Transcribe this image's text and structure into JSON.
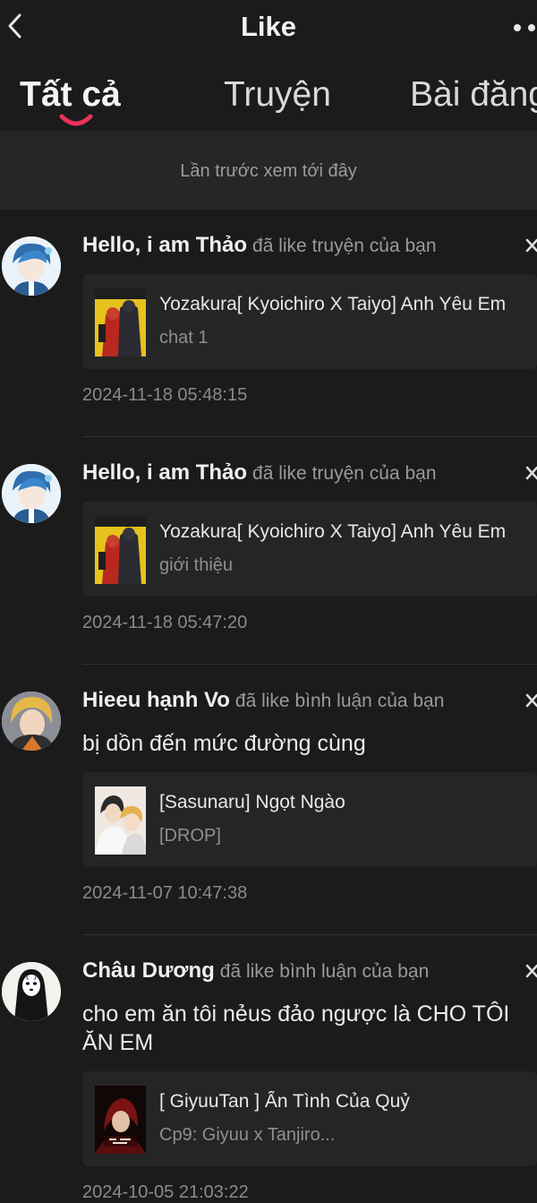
{
  "header": {
    "title": "Like",
    "back_icon": "chevron-left-icon",
    "more_icon": "more-dots-icon"
  },
  "tabs": [
    {
      "label": "Tất cả",
      "active": true
    },
    {
      "label": "Truyện",
      "active": false
    },
    {
      "label": "Bài đăng",
      "active": false
    }
  ],
  "banner": {
    "text": "Lần trước xem tới đây"
  },
  "notifications": [
    {
      "user": "Hello, i am Thảo",
      "action": "đã like truyện của bạn",
      "comment": "",
      "story_title": "Yozakura[ Kyoichiro X Taiyo] Anh Yêu Em",
      "story_sub": "chat 1",
      "time": "2024-11-18 05:48:15"
    },
    {
      "user": "Hello, i am Thảo",
      "action": "đã like truyện của bạn",
      "comment": "",
      "story_title": "Yozakura[ Kyoichiro X Taiyo] Anh Yêu Em",
      "story_sub": "giới thiệu",
      "time": "2024-11-18 05:47:20"
    },
    {
      "user": "Hieeu hạnh Vo",
      "action": "đã like bình luận của bạn",
      "comment": "bị dồn đến mức đường cùng",
      "story_title": "[Sasunaru] Ngọt Ngào",
      "story_sub": "[DROP]",
      "time": "2024-11-07 10:47:38"
    },
    {
      "user": "Châu Dương",
      "action": "đã like bình luận của bạn",
      "comment": "cho em ăn tôi nẻus đảo ngược là CHO TÔI ĂN EM",
      "story_title": "[ GiyuuTan ] Ấn Tình Của Quỷ",
      "story_sub": "Cp9: Giyuu x Tanjiro...",
      "time": "2024-10-05 21:03:22"
    }
  ],
  "colors": {
    "background": "#1b1b1b",
    "card": "#252525",
    "banner": "#262626",
    "accent": "#e8335a",
    "muted": "#9a9a9a"
  }
}
